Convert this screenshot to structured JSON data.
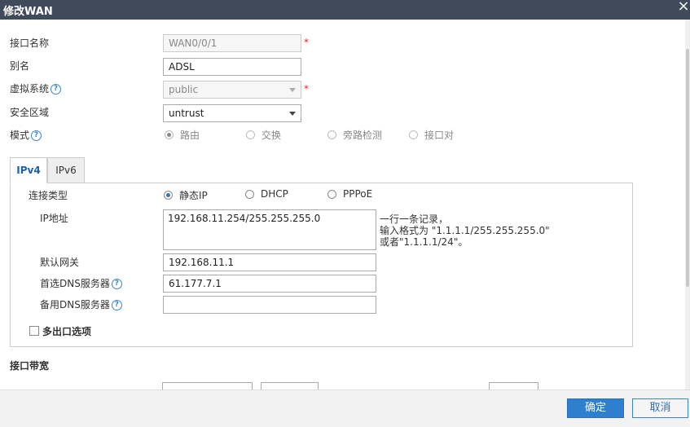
{
  "dialog": {
    "title": "修改WAN",
    "close_icon": "×"
  },
  "form": {
    "interface_name": {
      "label": "接口名称",
      "value": "WAN0/0/1",
      "required_mark": "*"
    },
    "alias": {
      "label": "别名",
      "value": "ADSL"
    },
    "vsys": {
      "label": "虚拟系统",
      "value": "public",
      "required_mark": "*",
      "help": "?"
    },
    "zone": {
      "label": "安全区域",
      "value": "untrust"
    },
    "mode": {
      "label": "模式",
      "help": "?",
      "options": [
        "路由",
        "交换",
        "旁路检测",
        "接口对"
      ],
      "selected": "路由"
    }
  },
  "tabs": [
    {
      "label": "IPv4",
      "active": true
    },
    {
      "label": "IPv6",
      "active": false
    }
  ],
  "ipv4": {
    "conn_type": {
      "label": "连接类型",
      "options": [
        "静态IP",
        "DHCP",
        "PPPoE"
      ],
      "selected": "静态IP"
    },
    "ip": {
      "label": "IP地址",
      "value": "192.168.11.254/255.255.255.0",
      "hint": [
        "一行一条记录，",
        "输入格式为 \"1.1.1.1/255.255.255.0\"",
        "或者\"1.1.1.1/24\"。"
      ]
    },
    "gateway": {
      "label": "默认网关",
      "value": "192.168.11.1"
    },
    "dns_primary": {
      "label": "首选DNS服务器",
      "value": "61.177.7.1",
      "help": "?"
    },
    "dns_backup": {
      "label": "备用DNS服务器",
      "value": "",
      "help": "?"
    },
    "multi_exit": {
      "label": "多出口选项",
      "checked": false
    }
  },
  "bandwidth": {
    "title": "接口带宽"
  },
  "buttons": {
    "ok": "确定",
    "cancel": "取消"
  },
  "colors": {
    "titlebar": "#3f4a5a",
    "primary": "#2f7fcf",
    "accent": "#1f5fa5"
  }
}
